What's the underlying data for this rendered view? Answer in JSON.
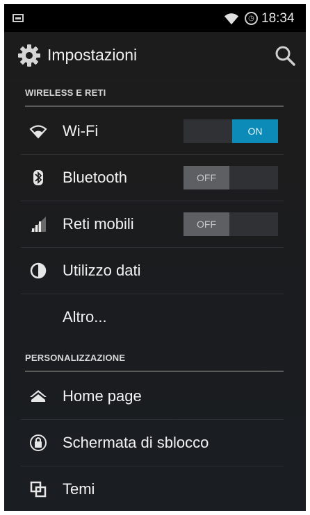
{
  "status_bar": {
    "time": "18:34"
  },
  "action_bar": {
    "title": "Impostazioni"
  },
  "sections": [
    {
      "header": "WIRELESS E RETI",
      "items": [
        {
          "label": "Wi-Fi",
          "icon": "wifi-icon",
          "toggle": "ON"
        },
        {
          "label": "Bluetooth",
          "icon": "bluetooth-icon",
          "toggle": "OFF"
        },
        {
          "label": "Reti mobili",
          "icon": "signal-icon",
          "toggle": "OFF"
        },
        {
          "label": "Utilizzo dati",
          "icon": "data-usage-icon"
        },
        {
          "label": "Altro..."
        }
      ]
    },
    {
      "header": "PERSONALIZZAZIONE",
      "items": [
        {
          "label": "Home page",
          "icon": "home-icon"
        },
        {
          "label": "Schermata di sblocco",
          "icon": "lock-icon"
        },
        {
          "label": "Temi",
          "icon": "themes-icon"
        }
      ]
    }
  ],
  "colors": {
    "toggle_on": "#0c8bb8",
    "toggle_off": "#5d5f62"
  }
}
